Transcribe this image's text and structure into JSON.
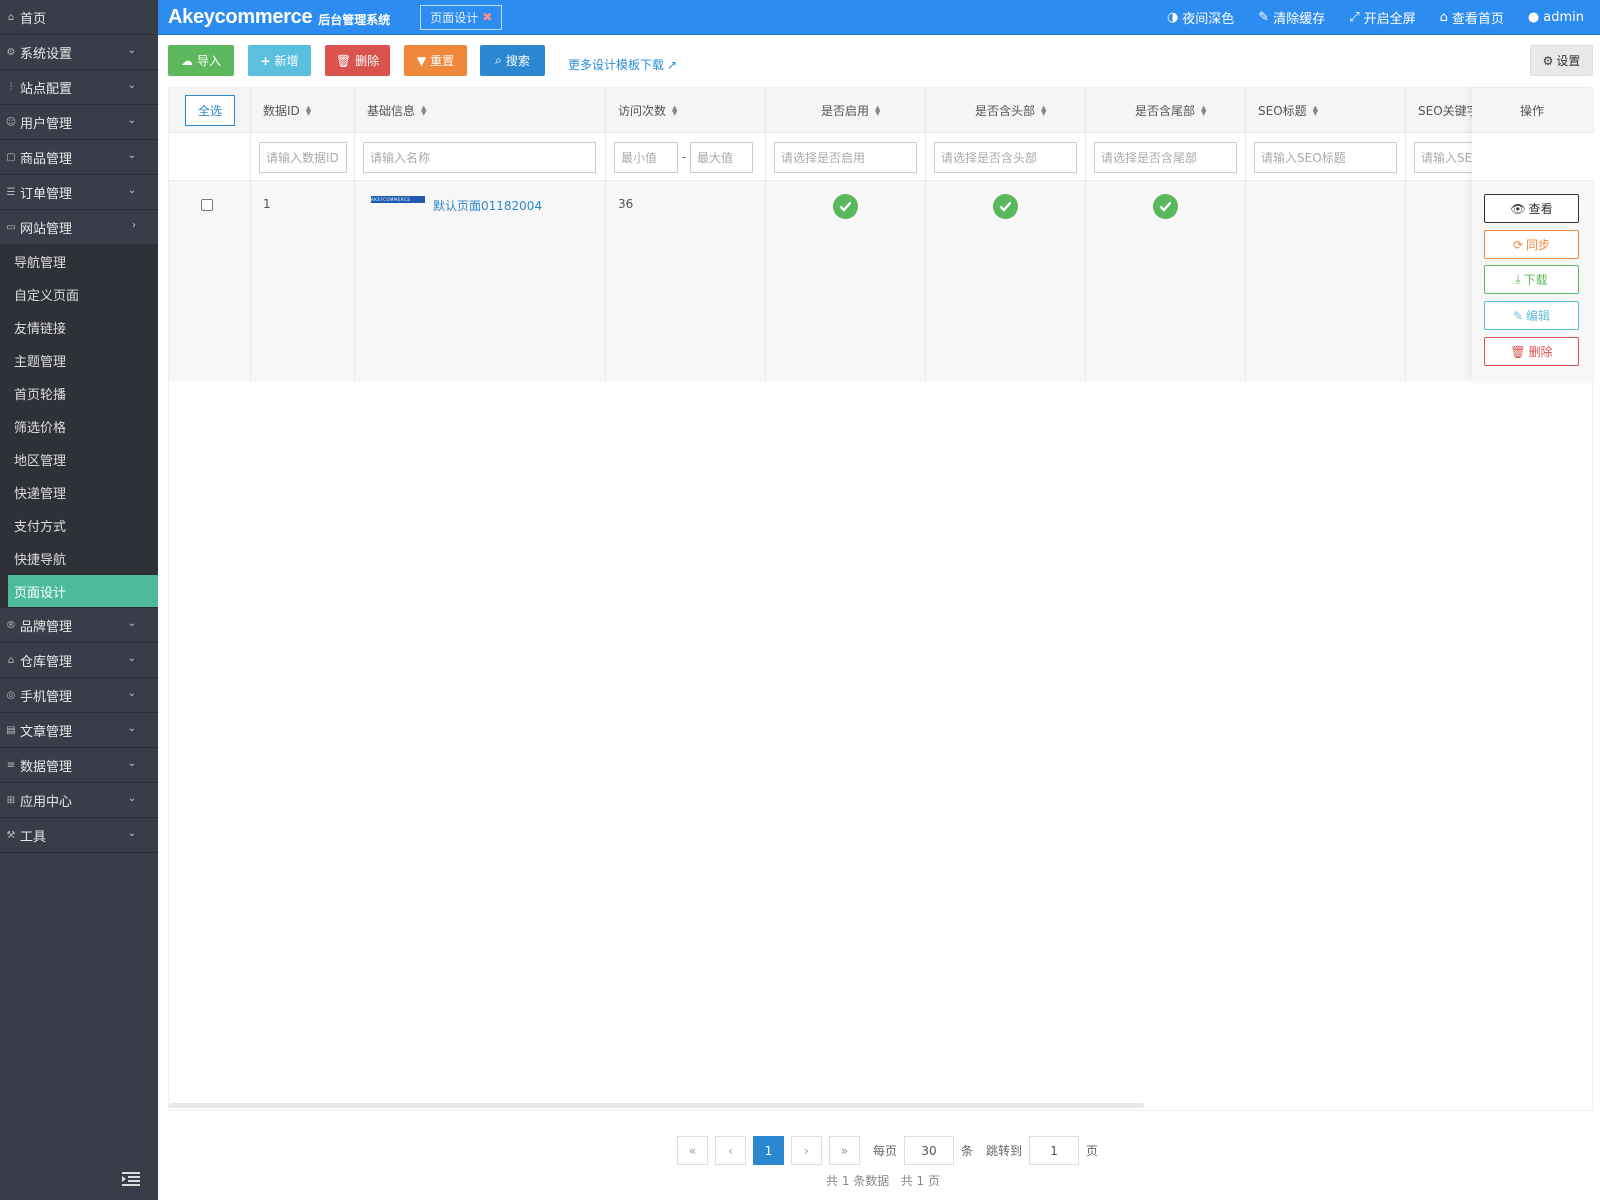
{
  "sidebar": {
    "top_items": [
      {
        "label": "首页",
        "icon": "home-icon"
      },
      {
        "label": "系统设置",
        "icon": "gear-icon"
      },
      {
        "label": "站点配置",
        "icon": "sliders-icon"
      },
      {
        "label": "用户管理",
        "icon": "user-icon"
      },
      {
        "label": "商品管理",
        "icon": "box-icon"
      },
      {
        "label": "订单管理",
        "icon": "list-icon"
      },
      {
        "label": "网站管理",
        "icon": "monitor-icon"
      }
    ],
    "sub_items": [
      {
        "label": "导航管理"
      },
      {
        "label": "自定义页面"
      },
      {
        "label": "友情链接"
      },
      {
        "label": "主题管理"
      },
      {
        "label": "首页轮播"
      },
      {
        "label": "筛选价格"
      },
      {
        "label": "地区管理"
      },
      {
        "label": "快递管理"
      },
      {
        "label": "支付方式"
      },
      {
        "label": "快捷导航"
      },
      {
        "label": "页面设计",
        "active": true
      }
    ],
    "bottom_items": [
      {
        "label": "品牌管理",
        "icon": "brand-icon"
      },
      {
        "label": "仓库管理",
        "icon": "warehouse-icon"
      },
      {
        "label": "手机管理",
        "icon": "mobile-icon"
      },
      {
        "label": "文章管理",
        "icon": "article-icon"
      },
      {
        "label": "数据管理",
        "icon": "database-icon"
      },
      {
        "label": "应用中心",
        "icon": "apps-icon"
      },
      {
        "label": "工具",
        "icon": "tools-icon"
      }
    ]
  },
  "header": {
    "brand": "Akeycommerce",
    "brand_sub": "后台管理系统",
    "tab_label": "页面设计",
    "night_mode": "夜间深色",
    "clear_cache": "清除缓存",
    "fullscreen": "开启全屏",
    "view_home": "查看首页",
    "user": "admin"
  },
  "toolbar": {
    "import": "导入",
    "add": "新增",
    "delete": "删除",
    "reset": "重置",
    "search": "搜索",
    "more_templates": "更多设计模板下载",
    "settings": "设置"
  },
  "table": {
    "select_all": "全选",
    "columns": {
      "id": "数据ID",
      "info": "基础信息",
      "visits": "访问次数",
      "enabled": "是否启用",
      "has_header": "是否含头部",
      "has_footer": "是否含尾部",
      "seo_title": "SEO标题",
      "seo_keywords": "SEO关键字",
      "actions": "操作"
    },
    "filters": {
      "id": "请输入数据ID",
      "name": "请输入名称",
      "visits_min": "最小值",
      "visits_max": "最大值",
      "enabled": "请选择是否启用",
      "has_header": "请选择是否含头部",
      "has_footer": "请选择是否含尾部",
      "seo_title": "请输入SEO标题",
      "seo_keywords": "请输入SEO"
    },
    "rows": [
      {
        "id": "1",
        "thumb": "AKEYCOMMERCE",
        "name": "默认页面01182004",
        "visits": "36",
        "enabled": true,
        "has_header": true,
        "has_footer": true,
        "seo_title": "",
        "seo_keywords": ""
      }
    ],
    "row_actions": {
      "view": "查看",
      "sync": "同步",
      "download": "下载",
      "edit": "编辑",
      "delete": "删除"
    }
  },
  "pagination": {
    "current": "1",
    "per_page_label": "每页",
    "per_page": "30",
    "per_page_unit": "条",
    "jump_label": "跳转到",
    "jump_value": "1",
    "page_unit": "页",
    "total_text": "共 1 条数据   共 1 页"
  },
  "colors": {
    "header": "#2D8CF0",
    "sidebar": "#393D49",
    "sidebar_active": "#4DBB9B",
    "success": "#5CB85C",
    "danger": "#D9534F",
    "warning": "#F0883C",
    "info": "#5BC0DE",
    "primary": "#2B88D0"
  }
}
